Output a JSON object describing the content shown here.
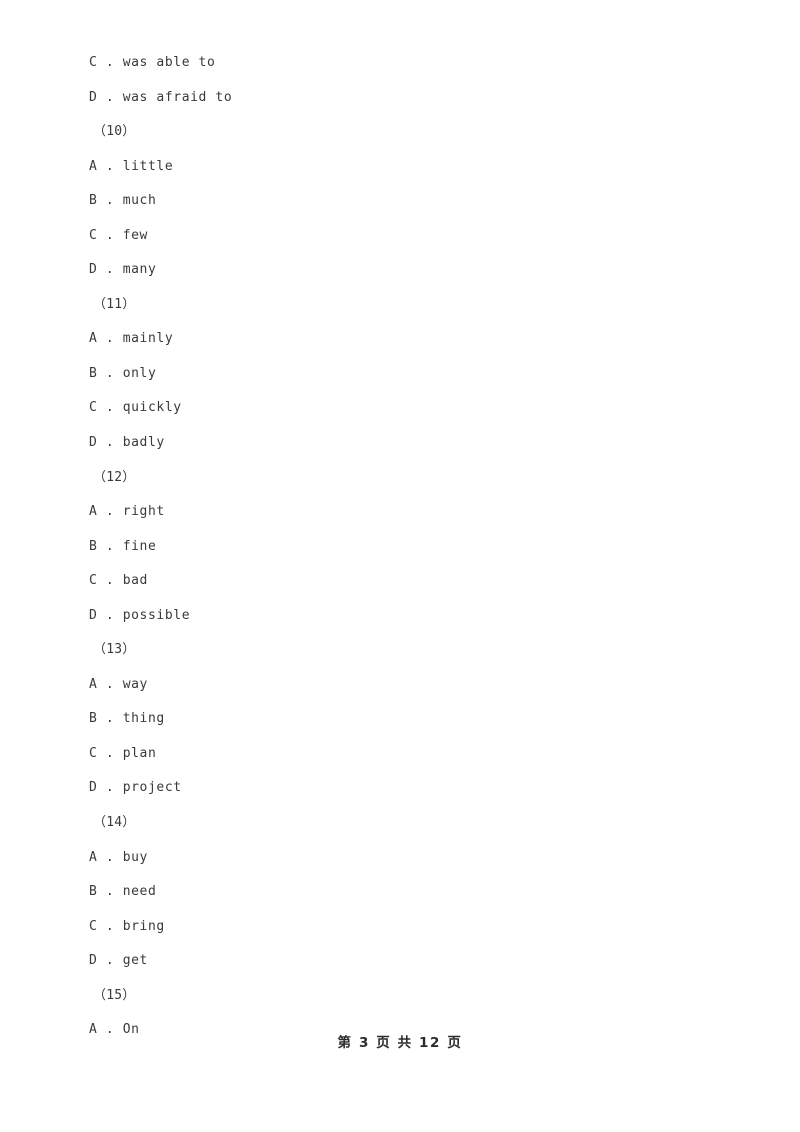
{
  "document": {
    "page_background": "#ffffff",
    "text_color": "#3a3a3a",
    "footer_color": "#2b2b2b"
  },
  "body_lines": [
    {
      "kind": "option",
      "text": "C . was able to"
    },
    {
      "kind": "option",
      "text": "D . was afraid to"
    },
    {
      "kind": "question",
      "text": "（10）"
    },
    {
      "kind": "option",
      "text": "A . little"
    },
    {
      "kind": "option",
      "text": "B . much"
    },
    {
      "kind": "option",
      "text": "C . few"
    },
    {
      "kind": "option",
      "text": "D . many"
    },
    {
      "kind": "question",
      "text": "（11）"
    },
    {
      "kind": "option",
      "text": "A . mainly"
    },
    {
      "kind": "option",
      "text": "B . only"
    },
    {
      "kind": "option",
      "text": "C . quickly"
    },
    {
      "kind": "option",
      "text": "D . badly"
    },
    {
      "kind": "question",
      "text": "（12）"
    },
    {
      "kind": "option",
      "text": "A . right"
    },
    {
      "kind": "option",
      "text": "B . fine"
    },
    {
      "kind": "option",
      "text": "C . bad"
    },
    {
      "kind": "option",
      "text": "D . possible"
    },
    {
      "kind": "question",
      "text": "（13）"
    },
    {
      "kind": "option",
      "text": "A . way"
    },
    {
      "kind": "option",
      "text": "B . thing"
    },
    {
      "kind": "option",
      "text": "C . plan"
    },
    {
      "kind": "option",
      "text": "D . project"
    },
    {
      "kind": "question",
      "text": "（14）"
    },
    {
      "kind": "option",
      "text": "A . buy"
    },
    {
      "kind": "option",
      "text": "B . need"
    },
    {
      "kind": "option",
      "text": "C . bring"
    },
    {
      "kind": "option",
      "text": "D . get"
    },
    {
      "kind": "question",
      "text": "（15）"
    },
    {
      "kind": "option",
      "text": "A . On"
    }
  ],
  "footer": {
    "text": "第 3 页 共 12 页",
    "current_page": "3",
    "total_pages": "12"
  }
}
